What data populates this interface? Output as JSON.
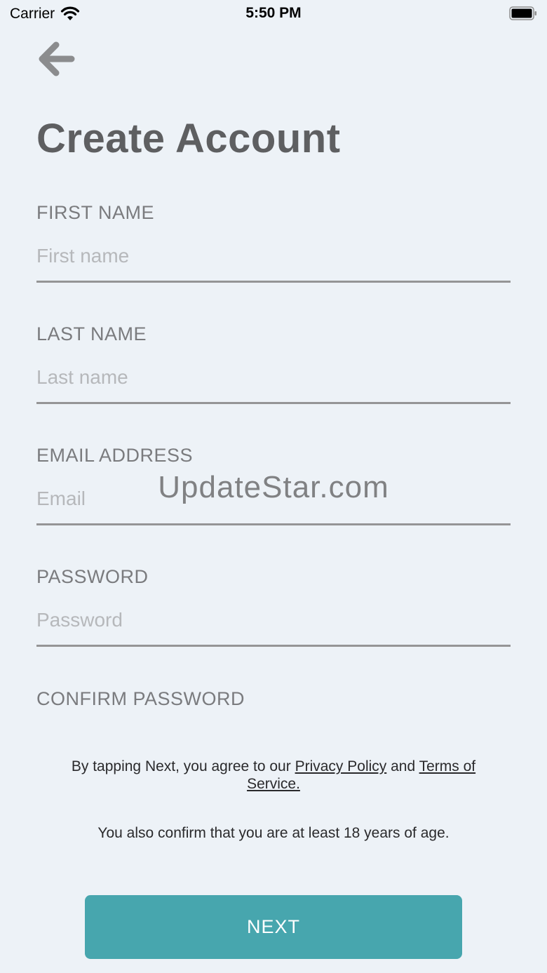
{
  "status_bar": {
    "carrier": "Carrier",
    "time": "5:50 PM"
  },
  "page": {
    "title": "Create Account"
  },
  "form": {
    "first_name": {
      "label": "FIRST NAME",
      "placeholder": "First name",
      "value": ""
    },
    "last_name": {
      "label": "LAST NAME",
      "placeholder": "Last name",
      "value": ""
    },
    "email": {
      "label": "EMAIL ADDRESS",
      "placeholder": "Email",
      "value": ""
    },
    "password": {
      "label": "PASSWORD",
      "placeholder": "Password",
      "value": ""
    },
    "confirm_password": {
      "label": "CONFIRM PASSWORD"
    }
  },
  "legal": {
    "prefix": "By tapping Next, you agree to our ",
    "privacy_link": "Privacy Policy",
    "conjunction": " and ",
    "terms_link": "Terms of Service.",
    "age_confirmation": "You also confirm that you are at least 18 years of age."
  },
  "watermark": "UpdateStar.com",
  "actions": {
    "next_label": "NEXT"
  },
  "icons": {
    "back": "arrow-left-icon",
    "wifi": "wifi-icon",
    "battery": "battery-icon"
  },
  "colors": {
    "background": "#edf2f7",
    "accent": "#47a6ae",
    "title": "#5e5f61",
    "label": "#7a7b7e",
    "placeholder": "#b6b8bb",
    "divider": "#959596"
  }
}
